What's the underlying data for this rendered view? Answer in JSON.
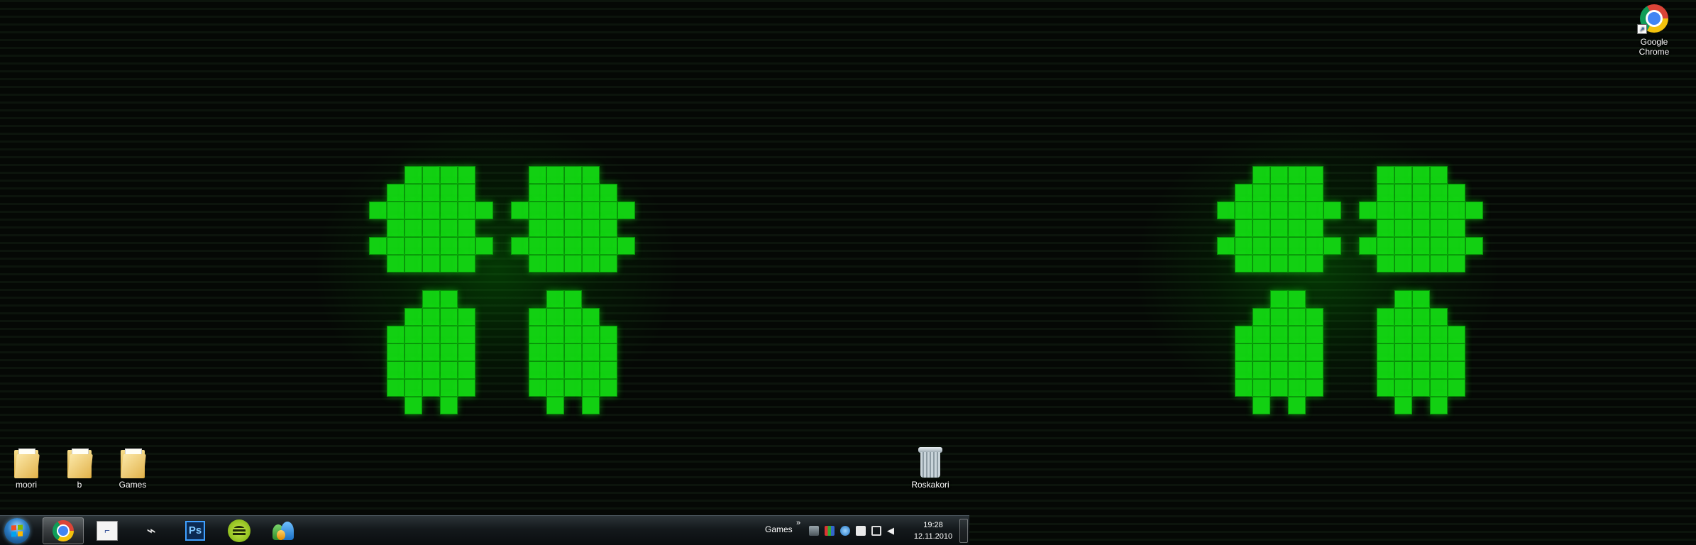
{
  "desktop": {
    "left_icons": [
      {
        "label": "moori",
        "type": "folder"
      },
      {
        "label": "b",
        "type": "folder"
      },
      {
        "label": "Games",
        "type": "folder"
      }
    ],
    "recycle_bin": {
      "label": "Roskakori",
      "icon": "recycle-bin-icon"
    },
    "right_icons": [
      {
        "label": "Google Chrome",
        "icon": "chrome-icon",
        "shortcut": true
      }
    ],
    "wallpaper": {
      "accent_color": "#12d012",
      "background_color": "#050805"
    }
  },
  "taskbar": {
    "start_icon": "windows-start-orb-icon",
    "pinned": [
      {
        "name": "chrome",
        "icon": "chrome-icon",
        "active": true
      },
      {
        "name": "app-window",
        "icon": "app-window-icon",
        "active": false
      },
      {
        "name": "steam",
        "icon": "steam-icon",
        "active": false
      },
      {
        "name": "photoshop",
        "icon": "photoshop-icon",
        "glyph": "Ps",
        "active": false
      },
      {
        "name": "spotify",
        "icon": "spotify-icon",
        "active": false
      },
      {
        "name": "messenger",
        "icon": "messenger-icon",
        "active": false
      }
    ],
    "toolbar_label": "Games",
    "toolbar_chevron": "»",
    "tray_icons": [
      "network-icon",
      "color-app-icon",
      "shield-icon",
      "battery-icon",
      "action-center-icon",
      "volume-icon"
    ],
    "clock": {
      "time": "19:28",
      "date": "12.11.2010"
    }
  }
}
